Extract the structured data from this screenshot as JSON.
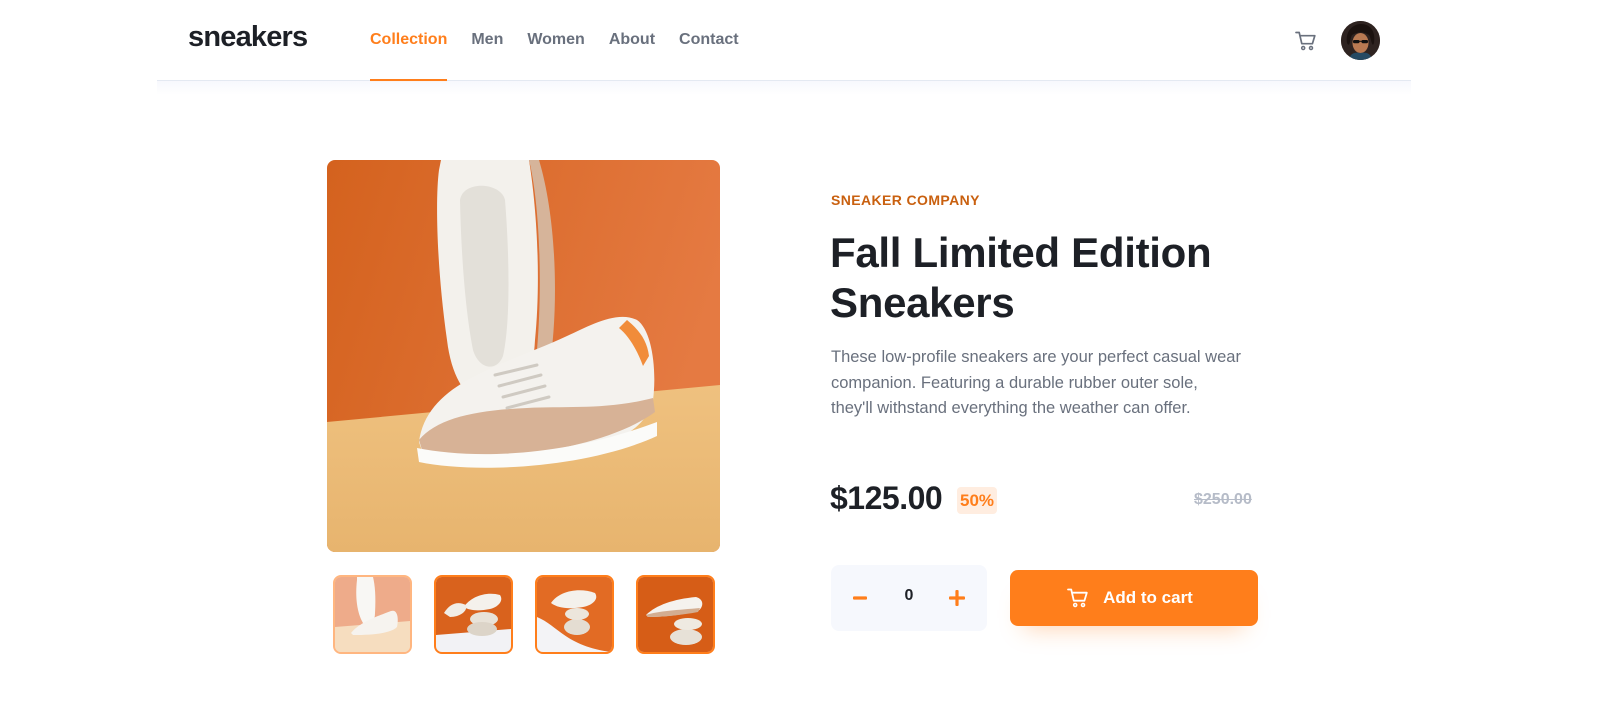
{
  "header": {
    "logo": "sneakers",
    "nav": [
      {
        "label": "Collection",
        "active": true
      },
      {
        "label": "Men",
        "active": false
      },
      {
        "label": "Women",
        "active": false
      },
      {
        "label": "About",
        "active": false
      },
      {
        "label": "Contact",
        "active": false
      }
    ],
    "cart_icon": "cart-icon",
    "avatar_icon": "avatar"
  },
  "gallery": {
    "main_image": "product-photo-1",
    "thumbnails": [
      {
        "name": "product-thumbnail-1",
        "active": true
      },
      {
        "name": "product-thumbnail-2",
        "active": false
      },
      {
        "name": "product-thumbnail-3",
        "active": false
      },
      {
        "name": "product-thumbnail-4",
        "active": false
      }
    ]
  },
  "product": {
    "company": "SNEAKER COMPANY",
    "title": "Fall Limited Edition Sneakers",
    "description": "These low-profile sneakers are your perfect casual wear companion. Featuring a durable rubber outer sole, they'll withstand everything the weather can offer.",
    "price": "$125.00",
    "discount": "50%",
    "original_price": "$250.00"
  },
  "purchase": {
    "quantity": "0",
    "minus_icon": "minus-icon",
    "plus_icon": "plus-icon",
    "add_to_cart_label": "Add to cart"
  },
  "colors": {
    "accent": "#ff7e1b",
    "accent_pale": "#ffede0",
    "text_dark": "#1d2026",
    "text_muted": "#69707d"
  }
}
